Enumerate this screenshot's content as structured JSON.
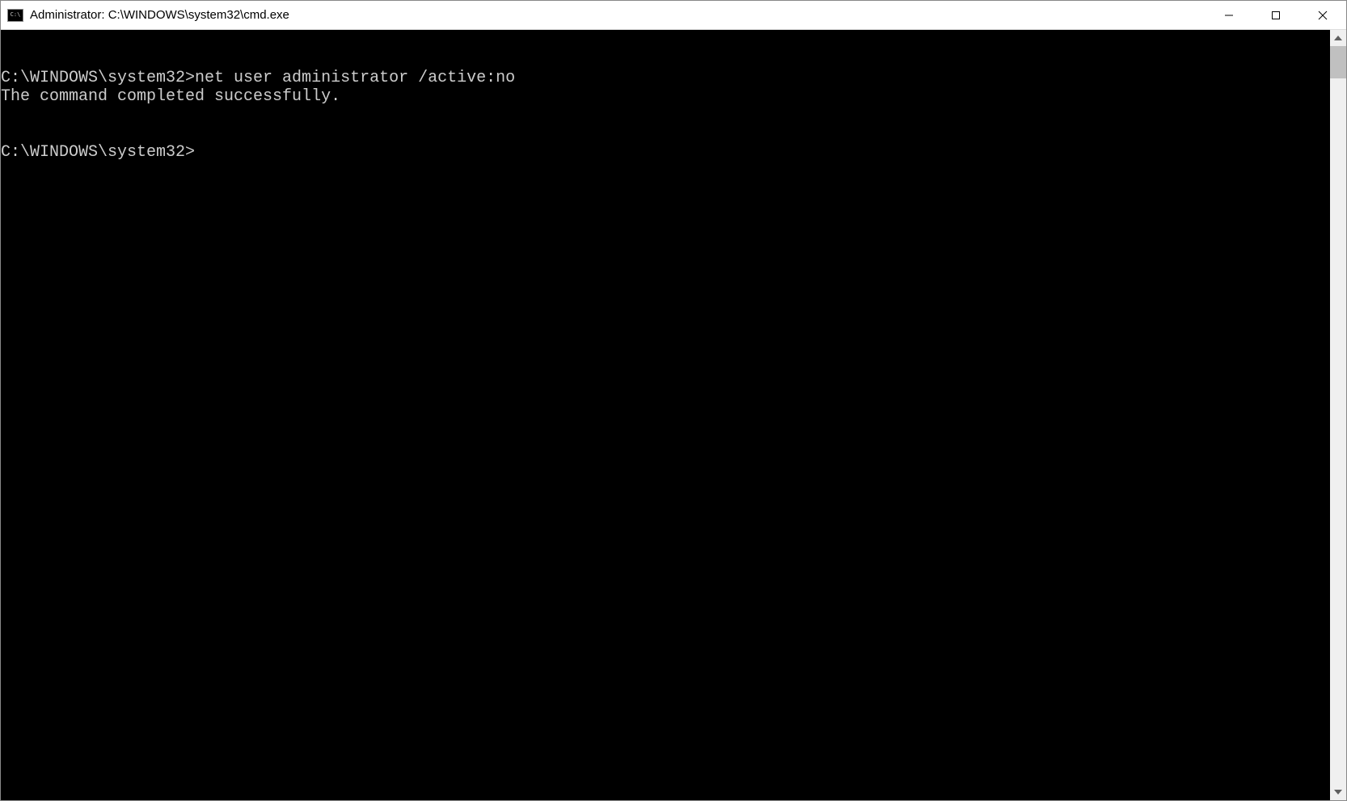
{
  "window": {
    "title": "Administrator: C:\\WINDOWS\\system32\\cmd.exe"
  },
  "terminal": {
    "lines": [
      "C:\\WINDOWS\\system32>net user administrator /active:no",
      "The command completed successfully.",
      "",
      "",
      "C:\\WINDOWS\\system32>"
    ]
  }
}
